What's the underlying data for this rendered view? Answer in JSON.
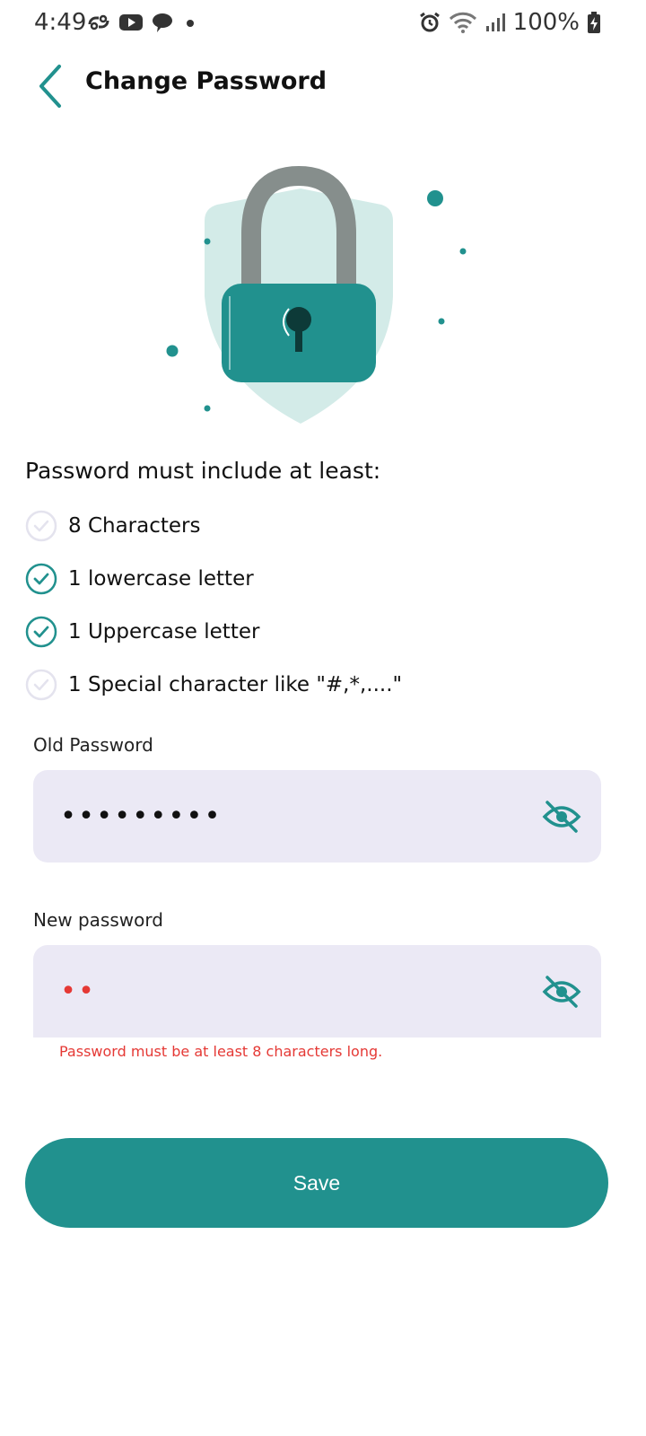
{
  "status_bar": {
    "time": "4:49",
    "battery": "100%"
  },
  "header": {
    "title": "Change Password",
    "back_icon": "chevron-left-icon"
  },
  "illustration": {
    "icon": "padlock-shield-illustration",
    "colors": {
      "shield": "#d3ebe8",
      "shackle": "#868e8c",
      "body": "#21918e",
      "keyhole": "#0d3a38"
    }
  },
  "requirements": {
    "heading": "Password must include at least:",
    "items": [
      {
        "label": "8 Characters",
        "met": false
      },
      {
        "label": "1 lowercase letter",
        "met": true
      },
      {
        "label": "1 Uppercase letter",
        "met": true
      },
      {
        "label": "1 Special character like \"#,*,....\"",
        "met": false
      }
    ]
  },
  "old_password": {
    "label": "Old Password",
    "value": "•••••••••"
  },
  "new_password": {
    "label": "New password",
    "value": "••",
    "error": "Password must be at least 8 characters long."
  },
  "save_button": {
    "label": "Save"
  },
  "colors": {
    "accent": "#21918e",
    "field_bg": "#ebe9f5",
    "error": "#e53935",
    "check_unmet": "#e4e3ee"
  }
}
